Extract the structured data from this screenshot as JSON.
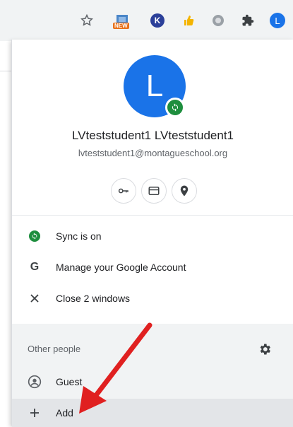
{
  "profile": {
    "avatar_letter": "L",
    "name": "LVteststudent1 LVteststudent1",
    "email": "lvteststudent1@montagueschool.org"
  },
  "menu": {
    "sync_label": "Sync is on",
    "manage_label": "Manage your Google Account",
    "close_label": "Close 2 windows"
  },
  "other_people": {
    "title": "Other people",
    "guest_label": "Guest",
    "add_label": "Add"
  },
  "toolbar": {
    "new_badge": "NEW",
    "k_letter": "K",
    "profile_letter": "L"
  },
  "colors": {
    "accent": "#1a73e8",
    "sync_green": "#1e8e3e",
    "arrow_red": "#e02020"
  }
}
